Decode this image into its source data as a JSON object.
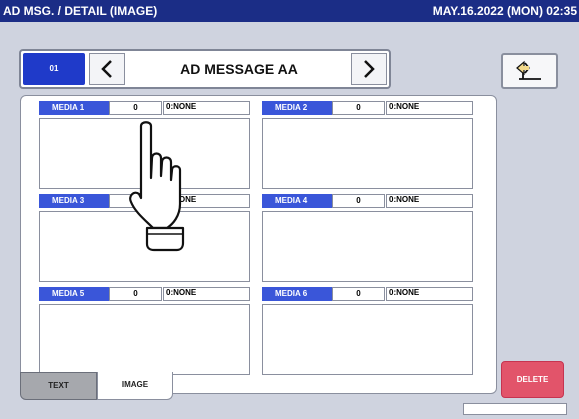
{
  "titlebar": {
    "screen_title": "AD MSG. / DETAIL (IMAGE)",
    "datetime": "MAY.16.2022 (MON) 02:35"
  },
  "nav": {
    "record_id": "01",
    "message_title": "AD MESSAGE AA",
    "prev_icon": "chevron-left-icon",
    "next_icon": "chevron-right-icon"
  },
  "back_icon": "return-arrow-icon",
  "media": [
    {
      "label": "MEDIA 1",
      "count": "0",
      "type": "0:NONE"
    },
    {
      "label": "MEDIA 2",
      "count": "0",
      "type": "0:NONE"
    },
    {
      "label": "MEDIA 3",
      "count": "0",
      "type": "0:NONE"
    },
    {
      "label": "MEDIA 4",
      "count": "0",
      "type": "0:NONE"
    },
    {
      "label": "MEDIA 5",
      "count": "0",
      "type": "0:NONE"
    },
    {
      "label": "MEDIA 6",
      "count": "0",
      "type": "0:NONE"
    }
  ],
  "tabs": {
    "text": "TEXT",
    "image": "IMAGE",
    "active": "image"
  },
  "delete_label": "DELETE",
  "colors": {
    "titlebar_bg": "#1b2d86",
    "media_label_bg": "#3a56d9",
    "delete_bg": "#e2546a",
    "screen_bg": "#cfd3df"
  }
}
